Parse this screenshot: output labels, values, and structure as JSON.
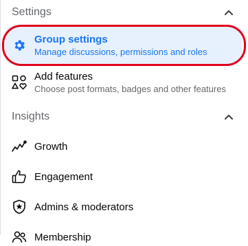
{
  "settings_section": {
    "title": "Settings",
    "items": [
      {
        "label": "Group settings",
        "sub": "Manage discussions, permissions and roles",
        "icon": "gear-icon",
        "selected": true
      },
      {
        "label": "Add features",
        "sub": "Choose post formats, badges and other features",
        "icon": "shapes-icon"
      }
    ]
  },
  "insights_section": {
    "title": "Insights",
    "items": [
      {
        "label": "Growth",
        "icon": "growth-chart-icon"
      },
      {
        "label": "Engagement",
        "icon": "thumbs-up-icon"
      },
      {
        "label": "Admins & moderators",
        "icon": "shield-star-icon"
      },
      {
        "label": "Membership",
        "icon": "people-icon"
      }
    ]
  },
  "colors": {
    "accent": "#1877f2",
    "selected_bg": "#e7f0fd",
    "highlight": "#e0001b",
    "muted": "#65676b"
  }
}
